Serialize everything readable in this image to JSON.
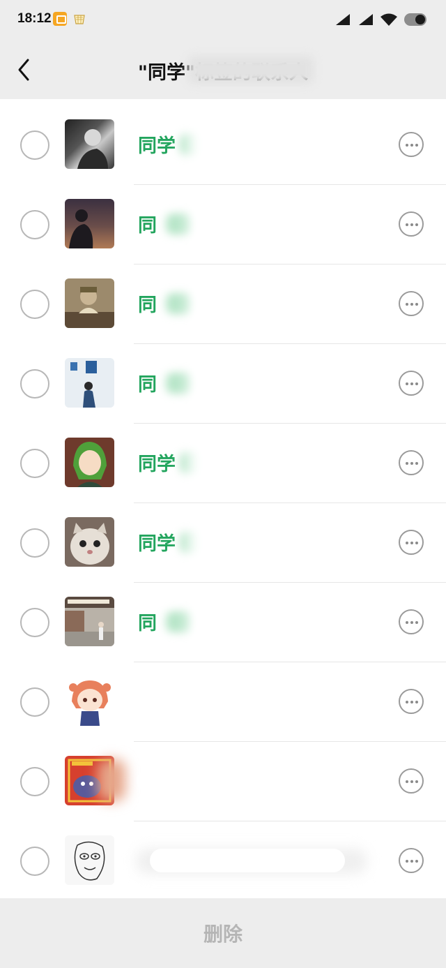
{
  "status_bar": {
    "time": "18:12"
  },
  "nav": {
    "title": "\"同学\"标签的联系人"
  },
  "contacts": [
    {
      "name": "同学"
    },
    {
      "name": "同"
    },
    {
      "name": "同"
    },
    {
      "name": "同"
    },
    {
      "name": "同学"
    },
    {
      "name": "同学"
    },
    {
      "name": "同"
    },
    {
      "name": ""
    },
    {
      "name": ""
    },
    {
      "name": ""
    }
  ],
  "footer": {
    "delete_label": "删除"
  },
  "colors": {
    "accent_green": "#23a55e",
    "bar_bg": "#ededed",
    "disabled_text": "#b5b5b5"
  }
}
